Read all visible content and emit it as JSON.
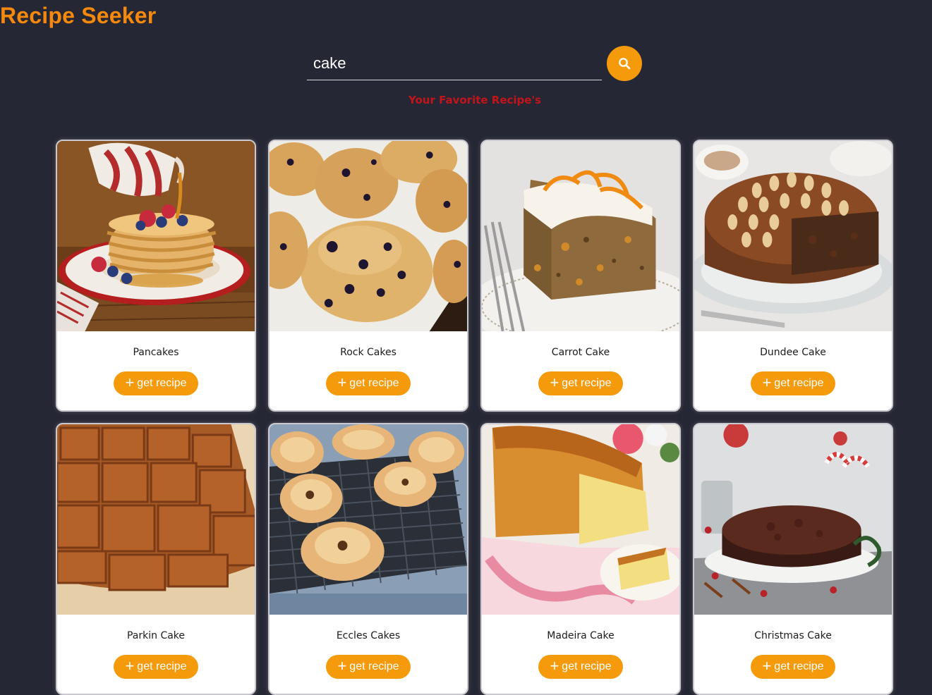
{
  "app": {
    "title": "Recipe Seeker",
    "accent_color": "#f5890c",
    "background_color": "#262734"
  },
  "search": {
    "value": "cake",
    "button_icon": "search-icon"
  },
  "subtitle": "Your Favorite Recipe's",
  "subtitle_color": "#c4141b",
  "recipes": [
    {
      "name": "Pancakes",
      "image": "pancakes-photo",
      "button_label": "get recipe",
      "button_icon": "plus-icon"
    },
    {
      "name": "Rock Cakes",
      "image": "rock-cakes-photo",
      "button_label": "get recipe",
      "button_icon": "plus-icon"
    },
    {
      "name": "Carrot Cake",
      "image": "carrot-cake-photo",
      "button_label": "get recipe",
      "button_icon": "plus-icon"
    },
    {
      "name": "Dundee Cake",
      "image": "dundee-cake-photo",
      "button_label": "get recipe",
      "button_icon": "plus-icon"
    },
    {
      "name": "Parkin Cake",
      "image": "parkin-cake-photo",
      "button_label": "get recipe",
      "button_icon": "plus-icon"
    },
    {
      "name": "Eccles Cakes",
      "image": "eccles-cakes-photo",
      "button_label": "get recipe",
      "button_icon": "plus-icon"
    },
    {
      "name": "Madeira Cake",
      "image": "madeira-cake-photo",
      "button_label": "get recipe",
      "button_icon": "plus-icon"
    },
    {
      "name": "Christmas Cake",
      "image": "christmas-cake-photo",
      "button_label": "get recipe",
      "button_icon": "plus-icon"
    }
  ]
}
